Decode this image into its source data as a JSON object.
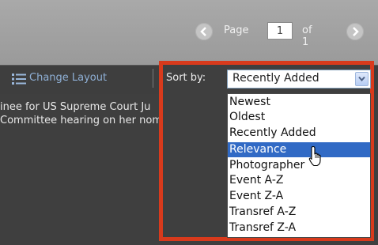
{
  "pager": {
    "page_label": "Page",
    "page_value": "1",
    "of_label": "of 1",
    "prev_icon": "chevron-left-icon",
    "next_icon": "chevron-right-icon"
  },
  "toolbar": {
    "change_layout": "Change Layout",
    "layout_icon": "list-layout-icon"
  },
  "captions": {
    "line1": "inee for US Supreme Court Ju",
    "line2": "Committee hearing on her nom"
  },
  "sort": {
    "label": "Sort by:",
    "selected": "Recently Added",
    "options": [
      "Newest",
      "Oldest",
      "Recently Added",
      "Relevance",
      "Photographer",
      "Event A-Z",
      "Event Z-A",
      "Transref A-Z",
      "Transref Z-A"
    ],
    "highlighted": "Relevance"
  },
  "colors": {
    "highlight_border": "#d83a1c",
    "selection": "#316ac5",
    "link": "#8fb0d6"
  }
}
